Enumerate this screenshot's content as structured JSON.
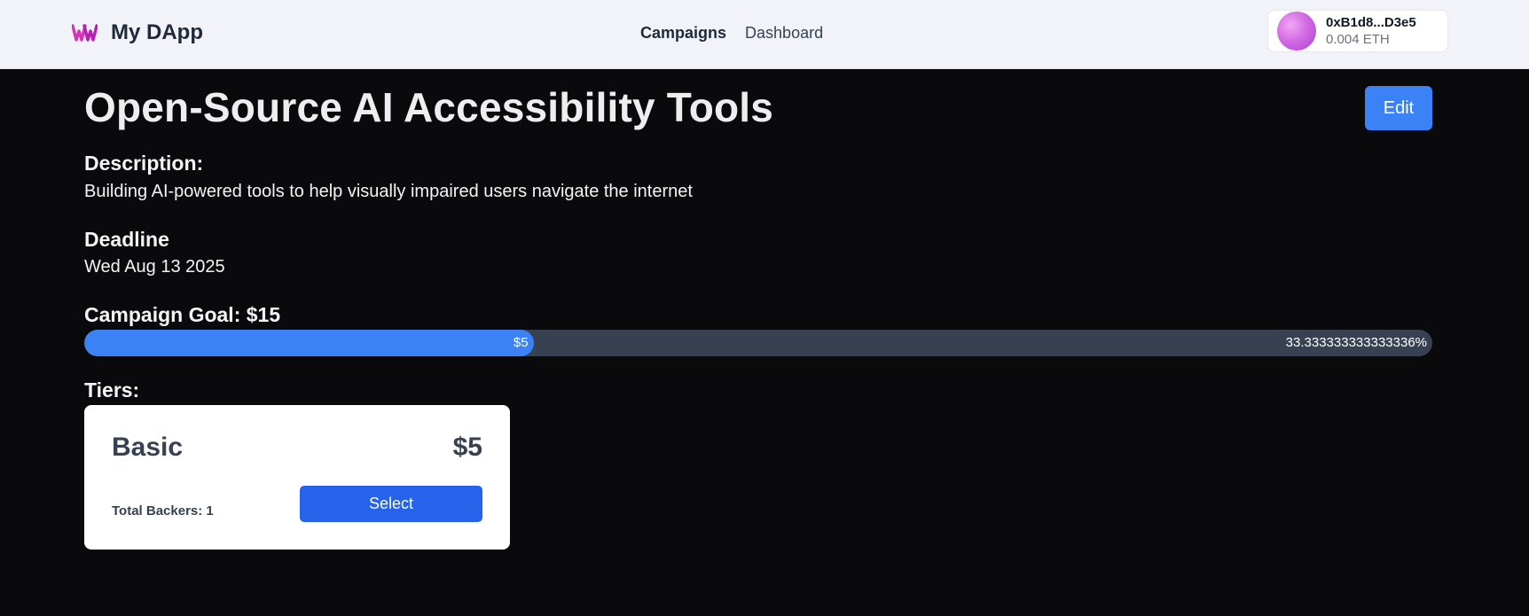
{
  "navbar": {
    "brand_name": "My DApp",
    "brand_icon": "wave-logo-icon",
    "links": [
      {
        "label": "Campaigns",
        "active": true
      },
      {
        "label": "Dashboard",
        "active": false
      }
    ],
    "wallet": {
      "address": "0xB1d8...D3e5",
      "balance": "0.004 ETH"
    }
  },
  "campaign": {
    "title": "Open-Source AI Accessibility Tools",
    "edit_label": "Edit",
    "description_label": "Description:",
    "description": "Building AI-powered tools to help visually impaired users navigate the internet",
    "deadline_label": "Deadline",
    "deadline": "Wed Aug 13 2025",
    "goal_label": "Campaign Goal: $15",
    "progress": {
      "raised_label": "$5",
      "percent_label": "33.333333333333336%",
      "fraction": 0.3333
    },
    "tiers_label": "Tiers:",
    "tiers": [
      {
        "name": "Basic",
        "amount": "$5",
        "backers": "Total Backers: 1",
        "select_label": "Select"
      }
    ]
  },
  "colors": {
    "accent": "#3b82f6",
    "select_button": "#2563eb",
    "page_background": "#0a0a0c",
    "navbar_background": "#f1f3f9",
    "track": "#374151"
  }
}
